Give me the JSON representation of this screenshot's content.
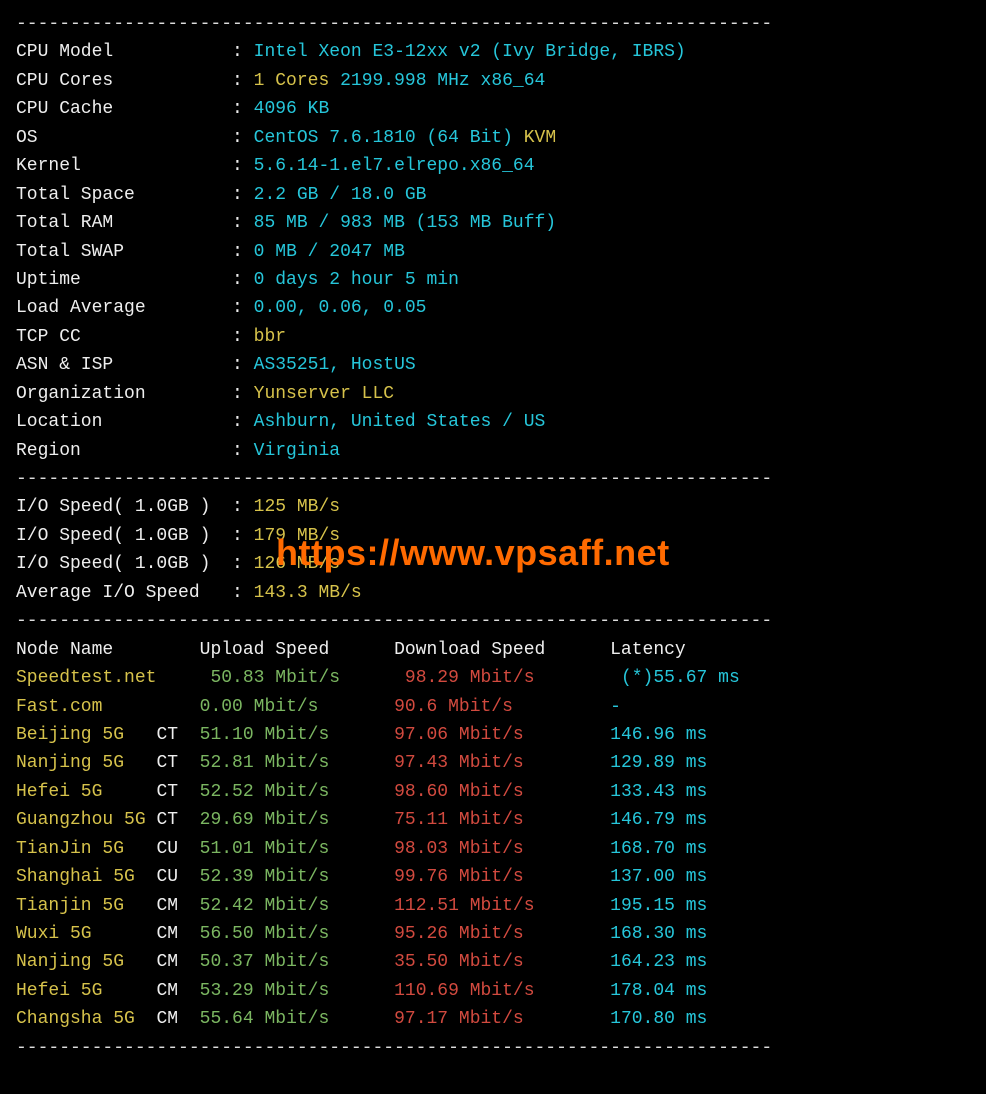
{
  "dash": "----------------------------------------------------------------------",
  "sys": {
    "cpu_model_lbl": "CPU Model",
    "cpu_model_val": "Intel Xeon E3-12xx v2 (Ivy Bridge, IBRS)",
    "cpu_cores_lbl": "CPU Cores",
    "cpu_cores_a": "1 Cores",
    "cpu_cores_b": "2199.998 MHz x86_64",
    "cpu_cache_lbl": "CPU Cache",
    "cpu_cache_val": "4096 KB",
    "os_lbl": "OS",
    "os_a": "CentOS 7.6.1810 (64 Bit)",
    "os_b": "KVM",
    "kernel_lbl": "Kernel",
    "kernel_val": "5.6.14-1.el7.elrepo.x86_64",
    "total_space_lbl": "Total Space",
    "total_space_val": "2.2 GB / 18.0 GB",
    "total_ram_lbl": "Total RAM",
    "total_ram_val": "85 MB / 983 MB (153 MB Buff)",
    "total_swap_lbl": "Total SWAP",
    "total_swap_val": "0 MB / 2047 MB",
    "uptime_lbl": "Uptime",
    "uptime_val": "0 days 2 hour 5 min",
    "load_lbl": "Load Average",
    "load_val": "0.00, 0.06, 0.05",
    "tcp_lbl": "TCP CC",
    "tcp_val": "bbr",
    "asn_lbl": "ASN & ISP",
    "asn_val": "AS35251, HostUS",
    "org_lbl": "Organization",
    "org_val": "Yunserver LLC",
    "loc_lbl": "Location",
    "loc_val": "Ashburn, United States / US",
    "region_lbl": "Region",
    "region_val": "Virginia"
  },
  "io": {
    "l1": "I/O Speed( 1.0GB )",
    "v1": "125 MB/s",
    "l2": "I/O Speed( 1.0GB )",
    "v2": "179 MB/s",
    "l3": "I/O Speed( 1.0GB )",
    "v3": "126 MB/s",
    "lavg": "Average I/O Speed",
    "vavg": "143.3 MB/s"
  },
  "hdr": {
    "node": "Node Name",
    "up": "Upload Speed",
    "dn": "Download Speed",
    "lat": "Latency"
  },
  "rows": [
    {
      "n": "Speedtest.net",
      "isp": "",
      "u": "50.83 Mbit/s",
      "d": "98.29 Mbit/s",
      "l": "(*)55.67 ms"
    },
    {
      "n": "Fast.com",
      "isp": "",
      "u": "0.00 Mbit/s",
      "d": "90.6 Mbit/s",
      "l": "-"
    },
    {
      "n": "Beijing 5G",
      "isp": "CT",
      "u": "51.10 Mbit/s",
      "d": "97.06 Mbit/s",
      "l": "146.96 ms"
    },
    {
      "n": "Nanjing 5G",
      "isp": "CT",
      "u": "52.81 Mbit/s",
      "d": "97.43 Mbit/s",
      "l": "129.89 ms"
    },
    {
      "n": "Hefei 5G",
      "isp": "CT",
      "u": "52.52 Mbit/s",
      "d": "98.60 Mbit/s",
      "l": "133.43 ms"
    },
    {
      "n": "Guangzhou 5G",
      "isp": "CT",
      "u": "29.69 Mbit/s",
      "d": "75.11 Mbit/s",
      "l": "146.79 ms"
    },
    {
      "n": "TianJin 5G",
      "isp": "CU",
      "u": "51.01 Mbit/s",
      "d": "98.03 Mbit/s",
      "l": "168.70 ms"
    },
    {
      "n": "Shanghai 5G",
      "isp": "CU",
      "u": "52.39 Mbit/s",
      "d": "99.76 Mbit/s",
      "l": "137.00 ms"
    },
    {
      "n": "Tianjin 5G",
      "isp": "CM",
      "u": "52.42 Mbit/s",
      "d": "112.51 Mbit/s",
      "l": "195.15 ms"
    },
    {
      "n": "Wuxi 5G",
      "isp": "CM",
      "u": "56.50 Mbit/s",
      "d": "95.26 Mbit/s",
      "l": "168.30 ms"
    },
    {
      "n": "Nanjing 5G",
      "isp": "CM",
      "u": "50.37 Mbit/s",
      "d": "35.50 Mbit/s",
      "l": "164.23 ms"
    },
    {
      "n": "Hefei 5G",
      "isp": "CM",
      "u": "53.29 Mbit/s",
      "d": "110.69 Mbit/s",
      "l": "178.04 ms"
    },
    {
      "n": "Changsha 5G",
      "isp": "CM",
      "u": "55.64 Mbit/s",
      "d": "97.17 Mbit/s",
      "l": "170.80 ms"
    }
  ],
  "watermark": "https://www.vpsaff.net"
}
